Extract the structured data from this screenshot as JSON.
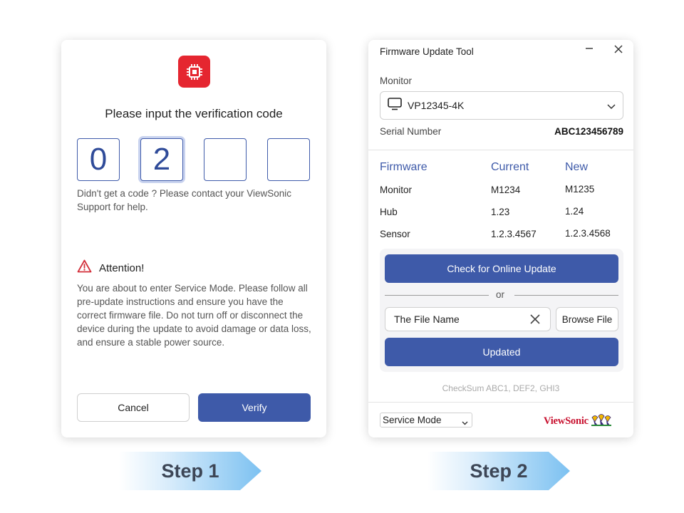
{
  "step1": {
    "title": "Please input the verification code",
    "code_digits": [
      "0",
      "2",
      "",
      ""
    ],
    "help_text": "Didn't get a code ? Please contact your ViewSonic Support for help.",
    "attention_title": "Attention!",
    "attention_body": "You are about to enter Service Mode. Please follow all pre-update instructions and ensure you have the correct firmware file. Do not turn off or disconnect the device during the update to avoid damage or data loss, and ensure a stable power source.",
    "cancel_label": "Cancel",
    "verify_label": "Verify",
    "step_label": "Step 1"
  },
  "step2": {
    "window_title": "Firmware Update Tool",
    "monitor_label": "Monitor",
    "monitor_value": "VP12345-4K",
    "serial_label": "Serial Number",
    "serial_value": "ABC123456789",
    "firmware_table": {
      "headers": [
        "Firmware",
        "Current",
        "New"
      ],
      "rows": [
        [
          "Monitor",
          "M1234",
          "M1235"
        ],
        [
          "Hub",
          "1.23",
          "1.24"
        ],
        [
          "Sensor",
          "1.2.3.4567",
          "1.2.3.4568"
        ]
      ]
    },
    "check_online_label": "Check for Online Update",
    "or_text": "or",
    "file_name_value": "The File Name",
    "browse_label": "Browse File",
    "updated_label": "Updated",
    "checksum_text": "CheckSum ABC1, DEF2, GHI3",
    "mode_value": "Service Mode",
    "brand_text": "ViewSonic",
    "step_label": "Step 2"
  },
  "colors": {
    "accent": "#3e5aa9",
    "brand_red": "#c8102e",
    "icon_red": "#e52630",
    "warning_red": "#d32f3a"
  },
  "icons": {
    "app": "chip-icon",
    "warning": "warning-triangle-icon",
    "monitor": "monitor-icon",
    "dropdown": "chevron-down-icon",
    "clear": "close-icon",
    "minimize": "minimize-icon",
    "close": "close-icon",
    "brand": "viewsonic-birds-logo"
  }
}
